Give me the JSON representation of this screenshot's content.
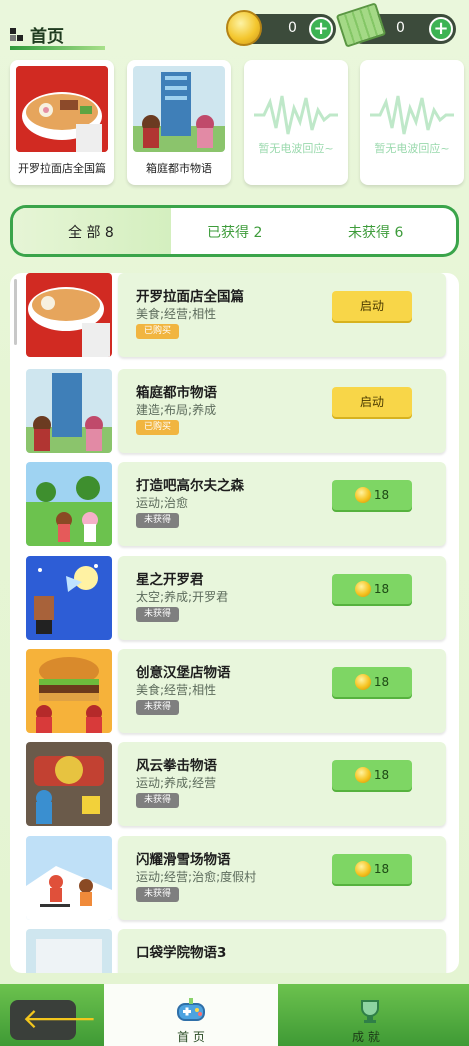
{
  "header": {
    "title": "首页"
  },
  "currency": {
    "coins": "0",
    "cash": "0"
  },
  "recent": [
    {
      "label": "开罗拉面店全国篇"
    },
    {
      "label": "箱庭都市物语"
    },
    {
      "label": "暂无电波回应~"
    },
    {
      "label": "暂无电波回应~"
    }
  ],
  "tabs": [
    {
      "label": "全 部 8"
    },
    {
      "label": "已获得 2"
    },
    {
      "label": "未获得 6"
    }
  ],
  "games": [
    {
      "name": "开罗拉面店全国篇",
      "tags": "美食;经营;相性",
      "badge": "已购买",
      "action": "启动"
    },
    {
      "name": "箱庭都市物语",
      "tags": "建造;布局;养成",
      "badge": "已购买",
      "action": "启动"
    },
    {
      "name": "打造吧高尔夫之森",
      "tags": "运动;治愈",
      "badge": "未获得",
      "price": "18"
    },
    {
      "name": "星之开罗君",
      "tags": "太空;养成;开罗君",
      "badge": "未获得",
      "price": "18"
    },
    {
      "name": "创意汉堡店物语",
      "tags": "美食;经营;相性",
      "badge": "未获得",
      "price": "18"
    },
    {
      "name": "风云拳击物语",
      "tags": "运动;养成;经营",
      "badge": "未获得",
      "price": "18"
    },
    {
      "name": "闪耀滑雪场物语",
      "tags": "运动;经营;治愈;度假村",
      "badge": "未获得",
      "price": "18"
    },
    {
      "name": "口袋学院物语3"
    }
  ],
  "nav": {
    "home": "首 页",
    "achievements": "成 就"
  },
  "colors": {
    "accent": "#3aa44a",
    "start": "#f8d648",
    "buy": "#7ed664"
  }
}
